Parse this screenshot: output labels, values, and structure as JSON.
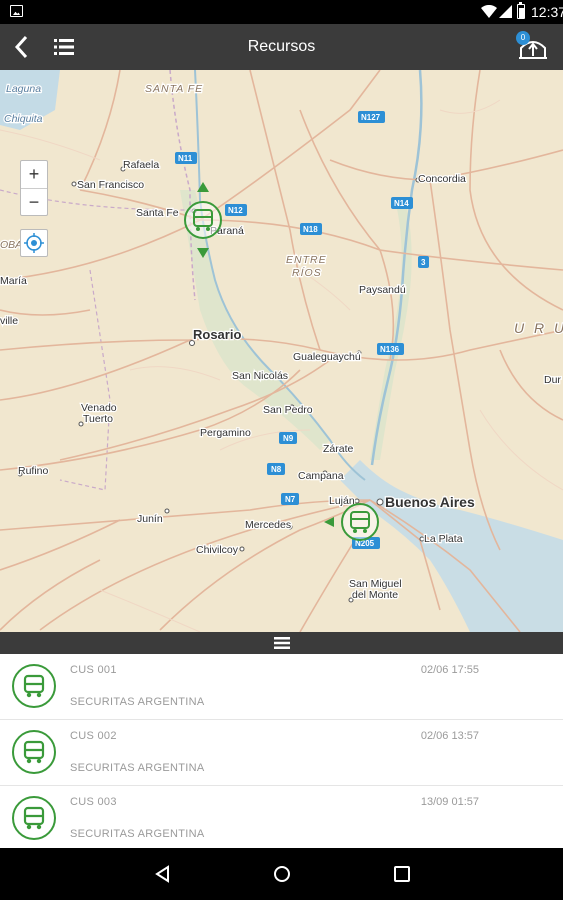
{
  "status_bar": {
    "time": "12:37"
  },
  "app_bar": {
    "title": "Recursos",
    "badge_count": "0"
  },
  "map": {
    "zoom_in": "+",
    "zoom_out": "−",
    "places": {
      "santa_fe_prov": "SANTA FE",
      "laguna": "Laguna",
      "chiquita": "Chiquita",
      "rafaela": "Rafaela",
      "san_francisco": "San Francisco",
      "santa_fe": "Santa Fe",
      "parana": "Paraná",
      "concordia": "Concordia",
      "entre": "ENTRE",
      "rios": "RÍOS",
      "paysandu": "Paysandú",
      "cordoba_frag": "OBA",
      "maria": "María",
      "ville": "ville",
      "rosario": "Rosario",
      "gualeguaychu": "Gualeguaychú",
      "uruguay_frag": "U R U",
      "dur": "Dur",
      "san_nicolas": "San Nicolás",
      "venado": "Venado",
      "tuerto": "Tuerto",
      "san_pedro": "San Pedro",
      "pergamino": "Pergamino",
      "zarate": "Zárate",
      "campana": "Campana",
      "rufino": "Rufino",
      "lujan": "Luján",
      "buenos_aires": "Buenos Aires",
      "junin": "Junín",
      "mercedes": "Mercedes",
      "la_plata": "La Plata",
      "chivilcoy": "Chivilcoy",
      "san_miguel": "San Miguel",
      "del_monte": "del Monte"
    },
    "routes": {
      "n11": "N11",
      "n127": "N127",
      "n12": "N12",
      "n14": "N14",
      "n18": "N18",
      "r3": "3",
      "n136": "N136",
      "n9": "N9",
      "n8": "N8",
      "n7": "N7",
      "n205": "N205"
    }
  },
  "resources": [
    {
      "name": "CUS 001",
      "time": "02/06 17:55",
      "org": "SECURITAS ARGENTINA"
    },
    {
      "name": "CUS 002",
      "time": "02/06 13:57",
      "org": "SECURITAS ARGENTINA"
    },
    {
      "name": "CUS 003",
      "time": "13/09 01:57",
      "org": "SECURITAS ARGENTINA"
    }
  ],
  "colors": {
    "accent_green": "#3a9a3a",
    "app_bar": "#3b3b3b",
    "route_shield": "#2d8fd5"
  }
}
